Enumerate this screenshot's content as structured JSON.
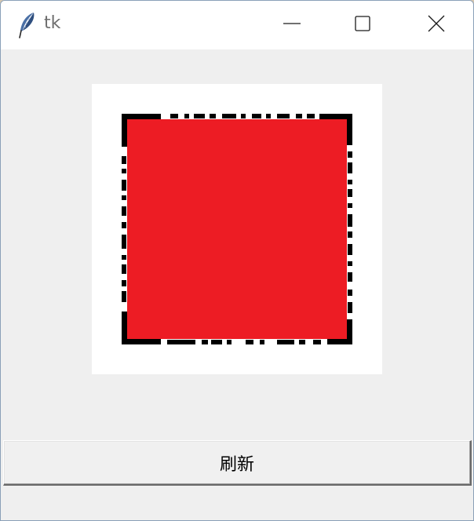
{
  "window": {
    "title": "tk"
  },
  "canvas": {
    "image_fill_color": "#ed1c24",
    "border_color": "#000000",
    "background_color": "#ffffff"
  },
  "controls": {
    "refresh_label": "刷新"
  },
  "icons": {
    "app": "feather-icon",
    "minimize": "minimize-icon",
    "maximize": "maximize-icon",
    "close": "close-icon"
  }
}
